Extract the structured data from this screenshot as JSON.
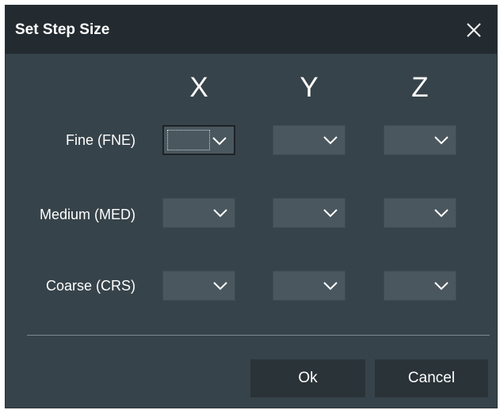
{
  "dialog": {
    "title": "Set Step Size",
    "close_icon": "close-icon",
    "columns": [
      "X",
      "Y",
      "Z"
    ],
    "rows": [
      {
        "label": "Fine (FNE)",
        "values": [
          "",
          "",
          ""
        ]
      },
      {
        "label": "Medium (MED)",
        "values": [
          "",
          "",
          ""
        ]
      },
      {
        "label": "Coarse (CRS)",
        "values": [
          "",
          "",
          ""
        ]
      }
    ],
    "focused_field": "Fine X",
    "buttons": {
      "ok": "Ok",
      "cancel": "Cancel"
    }
  },
  "colors": {
    "dialog_bg": "#37434a",
    "titlebar_bg": "#232b30",
    "combo_bg": "#4b575e",
    "button_bg": "#2a3338",
    "text": "#ffffff"
  }
}
